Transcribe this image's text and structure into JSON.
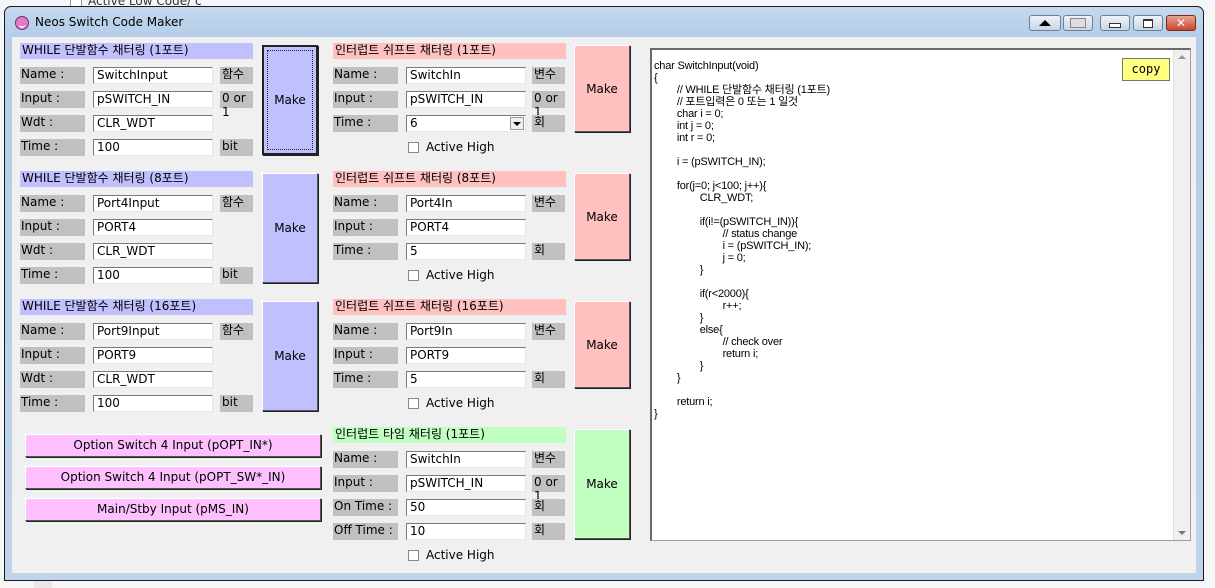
{
  "background": {
    "partial_text": "Active Low Code/ c"
  },
  "window": {
    "title": "Neos Switch Code Maker",
    "controls": [
      "up-arrow",
      "pin",
      "minimize",
      "maximize",
      "close"
    ]
  },
  "while_sections": [
    {
      "title": "WHILE 단발함수 채터링 (1포트)",
      "name_label": "Name :",
      "name_value": "SwitchInput",
      "name_unit": "함수",
      "input_label": "Input :",
      "input_value": "pSWITCH_IN",
      "input_unit": "0 or 1",
      "wdt_label": "Wdt :",
      "wdt_value": "CLR_WDT",
      "time_label": "Time :",
      "time_value": "100",
      "time_unit": "bit",
      "make_label": "Make"
    },
    {
      "title": "WHILE 단발함수 채터링 (8포트)",
      "name_label": "Name :",
      "name_value": "Port4Input",
      "name_unit": "함수",
      "input_label": "Input :",
      "input_value": "PORT4",
      "input_unit": "",
      "wdt_label": "Wdt :",
      "wdt_value": "CLR_WDT",
      "time_label": "Time :",
      "time_value": "100",
      "time_unit": "bit",
      "make_label": "Make"
    },
    {
      "title": "WHILE 단발함수 채터링 (16포트)",
      "name_label": "Name :",
      "name_value": "Port9Input",
      "name_unit": "함수",
      "input_label": "Input :",
      "input_value": "PORT9",
      "input_unit": "",
      "wdt_label": "Wdt :",
      "wdt_value": "CLR_WDT",
      "time_label": "Time :",
      "time_value": "100",
      "time_unit": "bit",
      "make_label": "Make"
    }
  ],
  "shift_sections": [
    {
      "title": "인터럽트 쉬프트 채터링 (1포트)",
      "name_label": "Name :",
      "name_value": "SwitchIn",
      "name_unit": "변수",
      "input_label": "Input :",
      "input_value": "pSWITCH_IN",
      "input_unit": "0 or 1",
      "time_label": "Time :",
      "time_value": "6",
      "time_unit": "회",
      "active_high_label": "Active High",
      "active_high_checked": false,
      "make_label": "Make"
    },
    {
      "title": "인터럽트 쉬프트 채터링 (8포트)",
      "name_label": "Name :",
      "name_value": "Port4In",
      "name_unit": "변수",
      "input_label": "Input :",
      "input_value": "PORT4",
      "input_unit": "",
      "time_label": "Time :",
      "time_value": "5",
      "time_unit": "회",
      "active_high_label": "Active High",
      "active_high_checked": false,
      "make_label": "Make"
    },
    {
      "title": "인터럽트 쉬프트 채터링 (16포트)",
      "name_label": "Name :",
      "name_value": "Port9In",
      "name_unit": "변수",
      "input_label": "Input :",
      "input_value": "PORT9",
      "input_unit": "",
      "time_label": "Time :",
      "time_value": "5",
      "time_unit": "회",
      "active_high_label": "Active High",
      "active_high_checked": false,
      "make_label": "Make"
    }
  ],
  "timer_section": {
    "title": "인터럽트 타임 채터링 (1포트)",
    "name_label": "Name :",
    "name_value": "SwitchIn",
    "name_unit": "변수",
    "input_label": "Input :",
    "input_value": "pSWITCH_IN",
    "input_unit": "0 or 1",
    "on_time_label": "On Time :",
    "on_time_value": "50",
    "on_time_unit": "회",
    "off_time_label": "Off Time :",
    "off_time_value": "10",
    "off_time_unit": "회",
    "active_high_label": "Active High",
    "active_high_checked": false,
    "make_label": "Make"
  },
  "option_buttons": [
    "Option Switch 4 Input (pOPT_IN*)",
    "Option Switch 4 Input (pOPT_SW*_IN)",
    "Main/Stby Input (pMS_IN)"
  ],
  "code_panel": {
    "copy_label": "copy",
    "code": "char SwitchInput(void)\n{\n\t// WHILE 단발함수 채터링 (1포트)\n\t// 포트입력은 0 또는 1 일것\n\tchar i = 0;\n\tint j = 0;\n\tint r = 0;\n\n\ti = (pSWITCH_IN);\n\n\tfor(j=0; j<100; j++){\n\t\tCLR_WDT;\n\n\t\tif(i!=(pSWITCH_IN)){\n\t\t\t// status change\n\t\t\ti = (pSWITCH_IN);\n\t\t\tj = 0;\n\t\t}\n\n\t\tif(r<2000){\n\t\t\tr++;\n\t\t}\n\t\telse{\n\t\t\t// check over\n\t\t\treturn i;\n\t\t}\n\t}\n\n\treturn i;\n}"
  }
}
